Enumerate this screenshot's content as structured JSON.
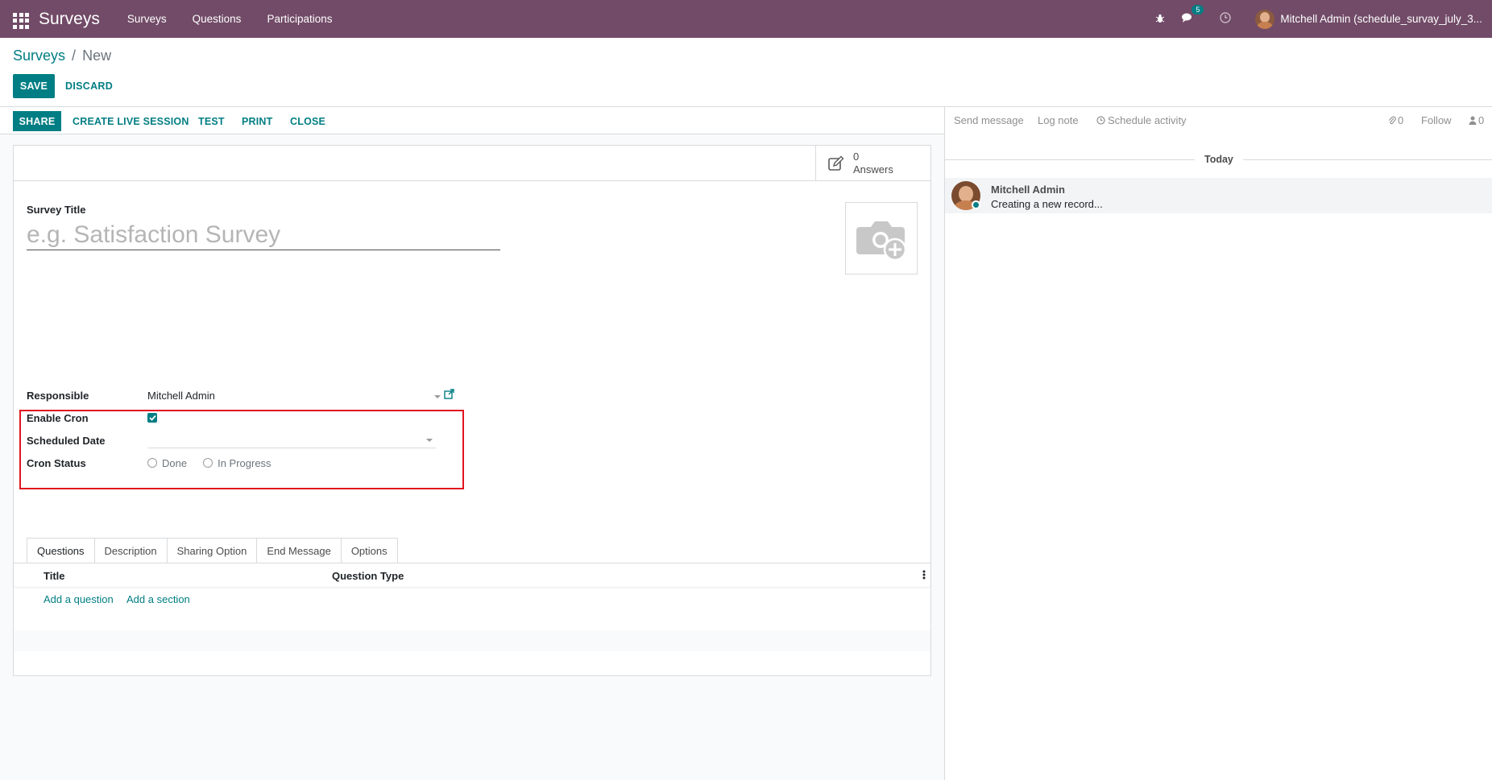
{
  "navbar": {
    "brand": "Surveys",
    "menu": [
      "Surveys",
      "Questions",
      "Participations"
    ],
    "messages_badge": "5",
    "user": "Mitchell Admin (schedule_survay_july_3..."
  },
  "breadcrumb": {
    "root": "Surveys",
    "separator": "/",
    "current": "New"
  },
  "control_panel": {
    "save": "SAVE",
    "discard": "DISCARD"
  },
  "header_buttons": {
    "share": "SHARE",
    "live": "CREATE LIVE SESSION",
    "test": "TEST",
    "print": "PRINT",
    "close": "CLOSE"
  },
  "stat_button": {
    "count": "0",
    "label": "Answers"
  },
  "form": {
    "title_label": "Survey Title",
    "title_placeholder": "e.g. Satisfaction Survey",
    "responsible_label": "Responsible",
    "responsible_value": "Mitchell Admin",
    "enable_cron_label": "Enable Cron",
    "enable_cron_checked": true,
    "scheduled_date_label": "Scheduled Date",
    "cron_status_label": "Cron Status",
    "cron_status_options": [
      "Done",
      "In Progress"
    ]
  },
  "tabs": [
    "Questions",
    "Description",
    "Sharing Option",
    "End Message",
    "Options"
  ],
  "questions_list": {
    "columns": {
      "title": "Title",
      "type": "Question Type"
    },
    "add_question": "Add a question",
    "add_section": "Add a section"
  },
  "chatter": {
    "send_message": "Send message",
    "log_note": "Log note",
    "schedule_activity": "Schedule activity",
    "attachments": "0",
    "follow": "Follow",
    "followers": "0",
    "date_separator": "Today",
    "message": {
      "author": "Mitchell Admin",
      "body": "Creating a new record..."
    }
  },
  "colors": {
    "navbar": "#714B67",
    "primary": "#017e84",
    "highlight": "#e0141e"
  }
}
